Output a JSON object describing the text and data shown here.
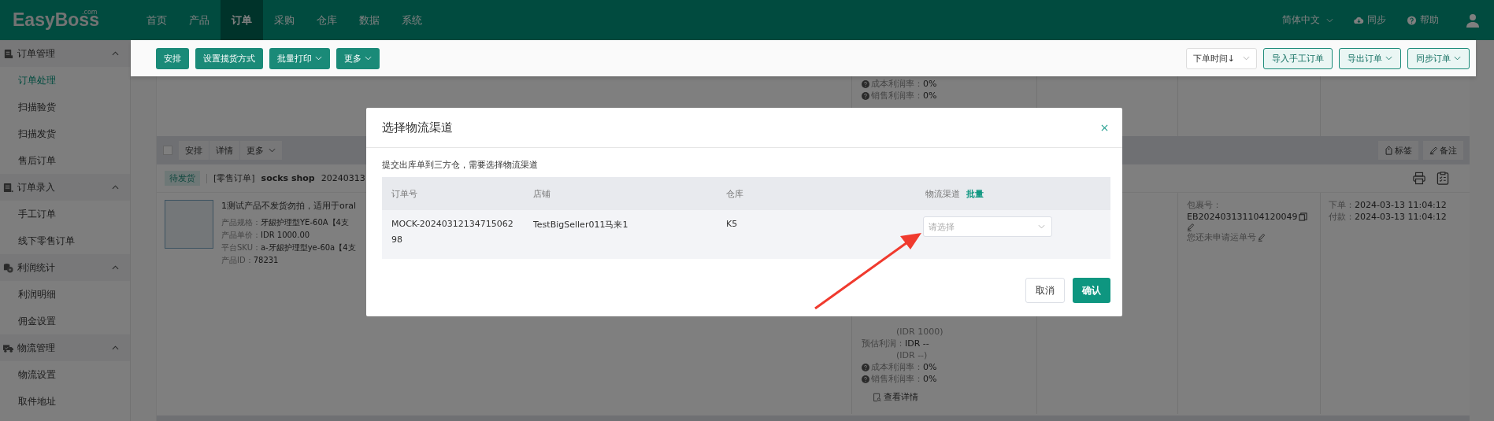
{
  "nav": {
    "logo": "EasyBoss",
    "logo_suffix": ".com",
    "items": [
      {
        "label": "首页",
        "selected": false
      },
      {
        "label": "产品",
        "selected": false
      },
      {
        "label": "订单",
        "selected": true
      },
      {
        "label": "采购",
        "selected": false
      },
      {
        "label": "仓库",
        "selected": false
      },
      {
        "label": "数据",
        "selected": false
      },
      {
        "label": "系统",
        "selected": false
      }
    ],
    "language": "简体中文",
    "sync": "同步",
    "help": "帮助"
  },
  "sidebar": [
    {
      "label": "订单管理",
      "expanded": true,
      "items": [
        {
          "label": "订单处理",
          "selected": true
        },
        {
          "label": "扫描验货",
          "selected": false
        },
        {
          "label": "扫描发货",
          "selected": false
        },
        {
          "label": "售后订单",
          "selected": false
        }
      ]
    },
    {
      "label": "订单录入",
      "expanded": true,
      "items": [
        {
          "label": "手工订单",
          "selected": false
        },
        {
          "label": "线下零售订单",
          "selected": false
        }
      ]
    },
    {
      "label": "利润统计",
      "expanded": true,
      "items": [
        {
          "label": "利润明细",
          "selected": false
        },
        {
          "label": "佣金设置",
          "selected": false
        }
      ]
    },
    {
      "label": "物流管理",
      "expanded": true,
      "items": [
        {
          "label": "物流设置",
          "selected": false
        },
        {
          "label": "取件地址",
          "selected": false
        }
      ]
    }
  ],
  "toolbar": {
    "actions": [
      {
        "label": "安排",
        "dropdown": false
      },
      {
        "label": "设置揽货方式",
        "dropdown": false
      },
      {
        "label": "批量打印",
        "dropdown": true
      },
      {
        "label": "更多",
        "dropdown": true
      }
    ],
    "sort": "下单时间↓",
    "buttons": [
      {
        "label": "导入手工订单",
        "dropdown": false
      },
      {
        "label": "导出订单",
        "dropdown": true
      },
      {
        "label": "同步订单",
        "dropdown": true
      }
    ]
  },
  "previous_order": {
    "margins": [
      {
        "label": "成本利润率：",
        "value": "0%"
      },
      {
        "label": "销售利润率：",
        "value": "0%"
      }
    ]
  },
  "order": {
    "checked": false,
    "actions": [
      {
        "label": "安排",
        "dropdown": false
      },
      {
        "label": "详情",
        "dropdown": false
      },
      {
        "label": "更多",
        "dropdown": true
      }
    ],
    "tag_button": "标签",
    "note_button": "备注",
    "status": "待发货",
    "type": "[零售订单]",
    "shop": "socks shop",
    "order_no": "20240313",
    "product": {
      "title": "1测试产品不发货勿拍，适用于oral",
      "details": [
        {
          "label": "产品规格：",
          "value": "牙龈护理型YE-60A【4支"
        },
        {
          "label": "产品单价：",
          "value": "IDR 1000.00"
        },
        {
          "label": "平台SKU：",
          "value": "a-牙龈护理型ye-60a【4支"
        },
        {
          "label": "产品ID：",
          "value": "78231"
        }
      ]
    },
    "profit": [
      {
        "kind": "sub",
        "value": "(IDR 1000)"
      },
      {
        "kind": "field",
        "label": "预估利润：",
        "value": "IDR --"
      },
      {
        "kind": "sub",
        "value": "(IDR --)"
      },
      {
        "kind": "margin",
        "label": "成本利润率：",
        "value": "0%"
      },
      {
        "kind": "margin",
        "label": "销售利润率：",
        "value": "0%"
      }
    ],
    "details_link": "查看详情",
    "package": {
      "label": "包裹号：",
      "number": "EB202403131104120049",
      "status": "您还未申请运单号"
    },
    "times": [
      {
        "label": "下单：",
        "value": "2024-03-13 11:04:12"
      },
      {
        "label": "付款：",
        "value": "2024-03-13 11:04:12"
      }
    ]
  },
  "modal": {
    "title": "选择物流渠道",
    "message": "提交出库单到三方仓，需要选择物流渠道",
    "columns": [
      "订单号",
      "店铺",
      "仓库",
      "物流渠道"
    ],
    "bulk_link": "批量",
    "rows": [
      {
        "order_no": "MOCK-2024031213471506298",
        "shop": "TestBigSeller011马来1",
        "warehouse": "K5",
        "channel_placeholder": "请选择"
      }
    ],
    "cancel": "取消",
    "confirm": "确认"
  }
}
